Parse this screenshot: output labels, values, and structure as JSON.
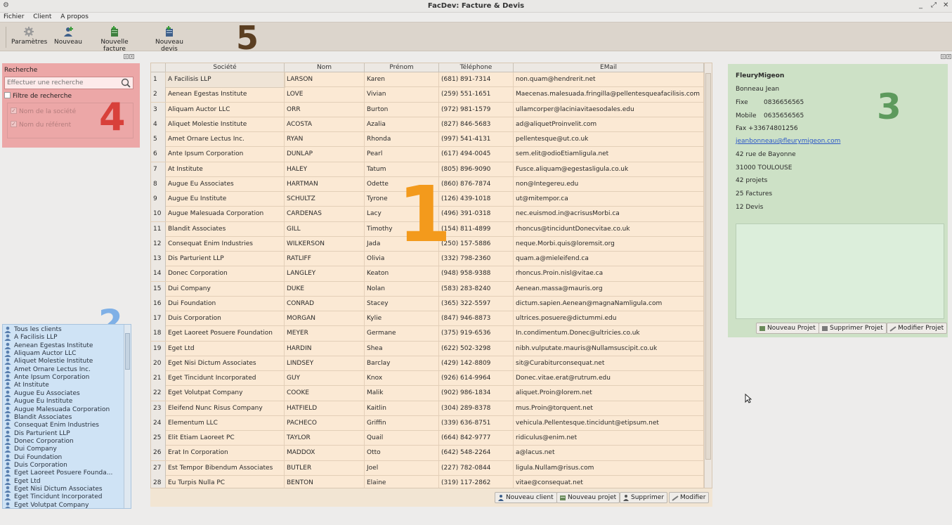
{
  "window": {
    "title": "FacDev: Facture & Devis"
  },
  "menu": [
    "Fichier",
    "Client",
    "A propos"
  ],
  "toolbar": [
    {
      "label": "Paramètres",
      "icon": "gear-icon"
    },
    {
      "label": "Nouveau",
      "icon": "add-user-icon"
    },
    {
      "label": "Nouvelle facture",
      "icon": "new-invoice-icon"
    },
    {
      "label": "Nouveau devis",
      "icon": "new-quote-icon"
    }
  ],
  "annotations": {
    "n1": "1",
    "n2": "2",
    "n3": "3",
    "n4": "4",
    "n5": "5"
  },
  "search": {
    "label": "Recherche",
    "placeholder": "Effectuer une recherche",
    "filter_label": "Filtre de recherche",
    "opt_company": "Nom de la société",
    "opt_referent": "Nom du référent"
  },
  "clients": [
    "Tous les clients",
    "A Facilisis LLP",
    "Aenean Egestas Institute",
    "Aliquam Auctor LLC",
    "Aliquet Molestie Institute",
    "Amet Ornare Lectus Inc.",
    "Ante Ipsum Corporation",
    "At Institute",
    "Augue Eu Associates",
    "Augue Eu Institute",
    "Augue Malesuada Corporation",
    "Blandit Associates",
    "Consequat Enim Industries",
    "Dis Parturient LLP",
    "Donec Corporation",
    "Dui Company",
    "Dui Foundation",
    "Duis Corporation",
    "Eget Laoreet Posuere Founda...",
    "Eget Ltd",
    "Eget Nisi Dictum Associates",
    "Eget Tincidunt Incorporated",
    "Eget Volutpat Company"
  ],
  "table": {
    "columns": [
      "Société",
      "Nom",
      "Prénom",
      "Téléphone",
      "EMail"
    ],
    "rows": [
      [
        "1",
        "A Facilisis LLP",
        "LARSON",
        "Karen",
        "(681) 891-7314",
        "non.quam@hendrerit.net"
      ],
      [
        "2",
        "Aenean Egestas Institute",
        "LOVE",
        "Vivian",
        "(259) 551-1651",
        "Maecenas.malesuada.fringilla@pellentesqueafacilisis.com"
      ],
      [
        "3",
        "Aliquam Auctor LLC",
        "ORR",
        "Burton",
        "(972) 981-1579",
        "ullamcorper@laciniavitaesodales.edu"
      ],
      [
        "4",
        "Aliquet Molestie Institute",
        "ACOSTA",
        "Azalia",
        "(827) 846-5683",
        "ad@aliquetProinvelit.com"
      ],
      [
        "5",
        "Amet Ornare Lectus Inc.",
        "RYAN",
        "Rhonda",
        "(997) 541-4131",
        "pellentesque@ut.co.uk"
      ],
      [
        "6",
        "Ante Ipsum Corporation",
        "DUNLAP",
        "Pearl",
        "(617) 494-0045",
        "sem.elit@odioEtiamligula.net"
      ],
      [
        "7",
        "At Institute",
        "HALEY",
        "Tatum",
        "(805) 896-9090",
        "Fusce.aliquam@egestasligula.co.uk"
      ],
      [
        "8",
        "Augue Eu Associates",
        "HARTMAN",
        "Odette",
        "(860) 876-7874",
        "non@Integereu.edu"
      ],
      [
        "9",
        "Augue Eu Institute",
        "SCHULTZ",
        "Tyrone",
        "(126) 439-1018",
        "ut@mitempor.ca"
      ],
      [
        "10",
        "Augue Malesuada Corporation",
        "CARDENAS",
        "Lacy",
        "(496) 391-0318",
        "nec.euismod.in@acrisusMorbi.ca"
      ],
      [
        "11",
        "Blandit Associates",
        "GILL",
        "Timothy",
        "(154) 811-4899",
        "rhoncus@tinciduntDonecvitae.co.uk"
      ],
      [
        "12",
        "Consequat Enim Industries",
        "WILKERSON",
        "Jada",
        "(250) 157-5886",
        "neque.Morbi.quis@loremsit.org"
      ],
      [
        "13",
        "Dis Parturient LLP",
        "RATLIFF",
        "Olivia",
        "(332) 798-2360",
        "quam.a@mieleifend.ca"
      ],
      [
        "14",
        "Donec Corporation",
        "LANGLEY",
        "Keaton",
        "(948) 958-9388",
        "rhoncus.Proin.nisl@vitae.ca"
      ],
      [
        "15",
        "Dui Company",
        "DUKE",
        "Nolan",
        "(583) 283-8240",
        "Aenean.massa@mauris.org"
      ],
      [
        "16",
        "Dui Foundation",
        "CONRAD",
        "Stacey",
        "(365) 322-5597",
        "dictum.sapien.Aenean@magnaNamligula.com"
      ],
      [
        "17",
        "Duis Corporation",
        "MORGAN",
        "Kylie",
        "(847) 946-8873",
        "ultrices.posuere@dictummi.edu"
      ],
      [
        "18",
        "Eget Laoreet Posuere Foundation",
        "MEYER",
        "Germane",
        "(375) 919-6536",
        "In.condimentum.Donec@ultricies.co.uk"
      ],
      [
        "19",
        "Eget Ltd",
        "HARDIN",
        "Shea",
        "(622) 502-3298",
        "nibh.vulputate.mauris@Nullamsuscipit.co.uk"
      ],
      [
        "20",
        "Eget Nisi Dictum Associates",
        "LINDSEY",
        "Barclay",
        "(429) 142-8809",
        "sit@Curabiturconsequat.net"
      ],
      [
        "21",
        "Eget Tincidunt Incorporated",
        "GUY",
        "Knox",
        "(926) 614-9964",
        "Donec.vitae.erat@rutrum.edu"
      ],
      [
        "22",
        "Eget Volutpat Company",
        "COOKE",
        "Malik",
        "(902) 986-1834",
        "aliquet.Proin@lorem.net"
      ],
      [
        "23",
        "Eleifend Nunc Risus Company",
        "HATFIELD",
        "Kaitlin",
        "(304) 289-8378",
        "mus.Proin@torquent.net"
      ],
      [
        "24",
        "Elementum LLC",
        "PACHECO",
        "Griffin",
        "(339) 636-8751",
        "vehicula.Pellentesque.tincidunt@etipsum.net"
      ],
      [
        "25",
        "Elit Etiam Laoreet PC",
        "TAYLOR",
        "Quail",
        "(664) 842-9777",
        "ridiculus@enim.net"
      ],
      [
        "26",
        "Erat In Corporation",
        "MADDOX",
        "Otto",
        "(642) 548-2264",
        "a@lacus.net"
      ],
      [
        "27",
        "Est Tempor Bibendum Associates",
        "BUTLER",
        "Joel",
        "(227) 782-0844",
        "ligula.Nullam@risus.com"
      ],
      [
        "28",
        "Eu Turpis Nulla PC",
        "BENTON",
        "Elaine",
        "(319) 117-2862",
        "vitae@consequat.net"
      ]
    ]
  },
  "table_buttons": {
    "new_client": "Nouveau client",
    "new_project": "Nouveau projet",
    "delete": "Supprimer",
    "edit": "Modifier"
  },
  "detail": {
    "company": "FleuryMigeon",
    "contact": "Bonneau Jean",
    "fixe_label": "Fixe",
    "fixe": "0836656565",
    "mobile_label": "Mobile",
    "mobile": "0635656565",
    "fax": "Fax +33674801256",
    "email": "jeanbonneau@fleurymigeon.com",
    "address": "42 rue de Bayonne",
    "city": "31000 TOULOUSE",
    "projects": "42 projets",
    "invoices": "25 Factures",
    "quotes": "12 Devis",
    "btn_new_project": "Nouveau Projet",
    "btn_delete_project": "Supprimer Projet",
    "btn_edit_project": "Modifier Projet"
  },
  "colors": {
    "search_panel": "#eca7a7",
    "client_list": "#cfe3f5",
    "table": "#fbe9d4",
    "detail_panel": "#cde1c6",
    "num1": "#f39a1c",
    "num2": "#7fb0e6",
    "num3": "#5d9a5d",
    "num4": "#d8403a",
    "num5": "#5b3f22"
  }
}
